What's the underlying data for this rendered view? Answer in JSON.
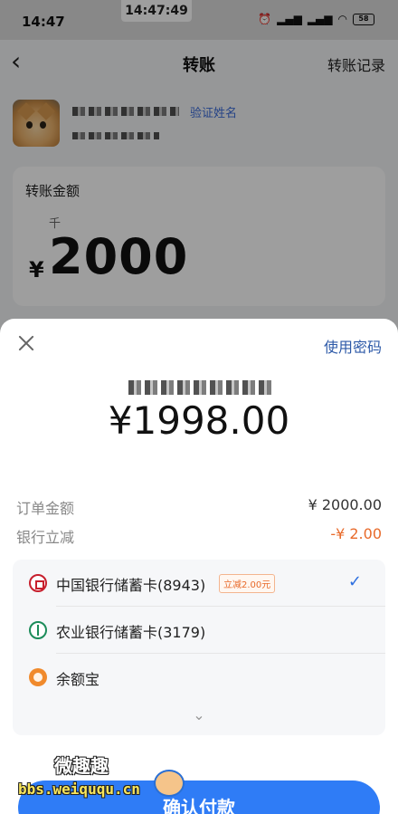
{
  "status_bar": {
    "time": "14:47",
    "clock_overlay": "14:47:49",
    "battery": "58"
  },
  "nav": {
    "back_icon": "chevron-left-icon",
    "title": "转账",
    "history_link": "转账记录"
  },
  "payee": {
    "verify_link": "验证姓名"
  },
  "transfer_card": {
    "label": "转账金额",
    "unit_hint": "千",
    "currency": "¥",
    "amount": "2000"
  },
  "pay_sheet": {
    "close_icon": "close-icon",
    "use_password": "使用密码",
    "pay_amount": "¥1998.00",
    "order_amount": {
      "label": "订单金额",
      "value": "¥ 2000.00"
    },
    "bank_discount": {
      "label": "银行立减",
      "value": "-¥ 2.00"
    },
    "methods": [
      {
        "name": "中国银行储蓄卡(8943)",
        "tag": "立减2.00元",
        "selected": true,
        "icon": "boc-icon"
      },
      {
        "name": "农业银行储蓄卡(3179)",
        "tag": "",
        "selected": false,
        "icon": "abc-icon"
      },
      {
        "name": "余额宝",
        "tag": "",
        "selected": false,
        "icon": "yuebao-icon"
      }
    ],
    "check_mark": "✓",
    "expand_icon": "chevron-down-icon",
    "expand_glyph": "⌄",
    "confirm_label": "确认付款"
  },
  "watermark": {
    "top": "微趣趣",
    "bottom": "bbs.weiququ.cn"
  },
  "colors": {
    "accent": "#2f7cf6",
    "discount": "#e86a2a",
    "link": "#2e5aa8"
  }
}
